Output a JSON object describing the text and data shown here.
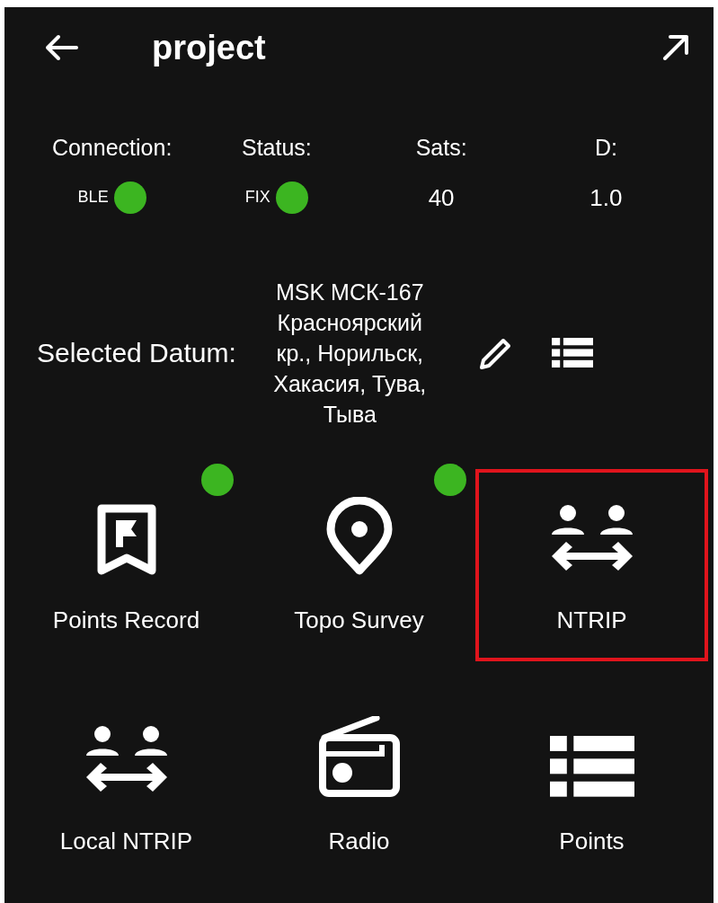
{
  "header": {
    "title": "project"
  },
  "stats": [
    {
      "label": "Connection:",
      "value": "BLE",
      "kind": "indicator",
      "color": "#3cb521"
    },
    {
      "label": "Status:",
      "value": "FIX",
      "kind": "indicator",
      "color": "#3cb521"
    },
    {
      "label": "Sats:",
      "value": "40",
      "kind": "number"
    },
    {
      "label": "D:",
      "value": "1.0",
      "kind": "number"
    }
  ],
  "datum": {
    "label": "Selected Datum:",
    "value": "MSK МСК-167 Красноярский кр., Норильск, Хакасия, Тува, Тыва"
  },
  "tiles": [
    {
      "label": "Points Record",
      "kind": "flag",
      "badge": true,
      "highlighted": false
    },
    {
      "label": "Topo Survey",
      "kind": "pin",
      "badge": true,
      "highlighted": false
    },
    {
      "label": "NTRIP",
      "kind": "people",
      "badge": false,
      "highlighted": true
    },
    {
      "label": "Local NTRIP",
      "kind": "people",
      "badge": false,
      "highlighted": false
    },
    {
      "label": "Radio",
      "kind": "radio",
      "badge": false,
      "highlighted": false
    },
    {
      "label": "Points",
      "kind": "list",
      "badge": false,
      "highlighted": false
    }
  ]
}
